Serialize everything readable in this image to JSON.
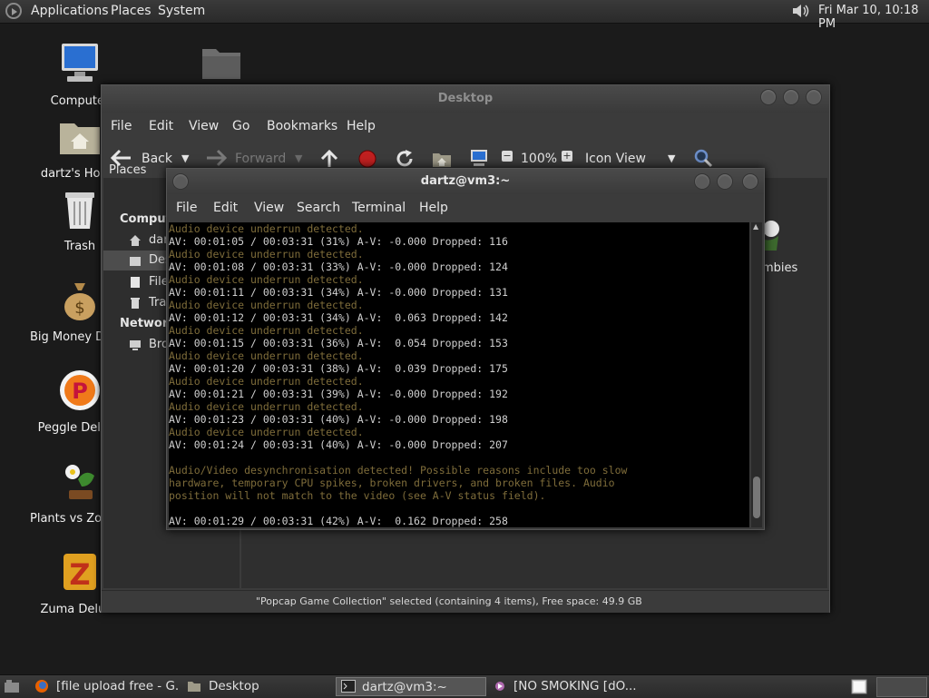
{
  "top_panel": {
    "menus": [
      "Applications",
      "Places",
      "System"
    ],
    "clock": "Fri Mar 10, 10:18 PM"
  },
  "desktop_icons": [
    {
      "label": "Computer",
      "icon": "computer-icon"
    },
    {
      "label": "dartz's Home",
      "icon": "home-folder-icon"
    },
    {
      "label": "Trash",
      "icon": "trash-icon"
    },
    {
      "label": "Big Money Deluxe",
      "icon": "money-bag-icon"
    },
    {
      "label": "Peggle Deluxe",
      "icon": "peggle-icon"
    },
    {
      "label": "Plants vs Zombies",
      "icon": "plants-icon"
    },
    {
      "label": "Zuma Deluxe",
      "icon": "zuma-icon"
    }
  ],
  "file_manager": {
    "title": "Desktop",
    "menu": [
      "File",
      "Edit",
      "View",
      "Go",
      "Bookmarks",
      "Help"
    ],
    "toolbar": {
      "back": "Back",
      "forward": "Forward",
      "zoom": "100%",
      "view_mode": "Icon View"
    },
    "sidebar_title": "Places",
    "sidebar": {
      "computer_header": "Computer",
      "items": [
        "dartz",
        "Desktop",
        "File System",
        "Trash"
      ],
      "network_header": "Network",
      "network_items": [
        "Browse Network"
      ]
    },
    "content_partial_label": "ombies",
    "status": "\"Popcap Game Collection\" selected (containing 4 items), Free space: 49.9 GB"
  },
  "terminal": {
    "title": "dartz@vm3:~",
    "menu": [
      "File",
      "Edit",
      "View",
      "Search",
      "Terminal",
      "Help"
    ],
    "lines": [
      {
        "text": "Audio device underrun detected.",
        "kind": "warn"
      },
      {
        "text": "AV: 00:01:05 / 00:03:31 (31%) A-V: -0.000 Dropped: 116",
        "kind": "norm"
      },
      {
        "text": "Audio device underrun detected.",
        "kind": "warn"
      },
      {
        "text": "AV: 00:01:08 / 00:03:31 (33%) A-V: -0.000 Dropped: 124",
        "kind": "norm"
      },
      {
        "text": "Audio device underrun detected.",
        "kind": "warn"
      },
      {
        "text": "AV: 00:01:11 / 00:03:31 (34%) A-V: -0.000 Dropped: 131",
        "kind": "norm"
      },
      {
        "text": "Audio device underrun detected.",
        "kind": "warn"
      },
      {
        "text": "AV: 00:01:12 / 00:03:31 (34%) A-V:  0.063 Dropped: 142",
        "kind": "norm"
      },
      {
        "text": "Audio device underrun detected.",
        "kind": "warn"
      },
      {
        "text": "AV: 00:01:15 / 00:03:31 (36%) A-V:  0.054 Dropped: 153",
        "kind": "norm"
      },
      {
        "text": "Audio device underrun detected.",
        "kind": "warn"
      },
      {
        "text": "AV: 00:01:20 / 00:03:31 (38%) A-V:  0.039 Dropped: 175",
        "kind": "norm"
      },
      {
        "text": "Audio device underrun detected.",
        "kind": "warn"
      },
      {
        "text": "AV: 00:01:21 / 00:03:31 (39%) A-V: -0.000 Dropped: 192",
        "kind": "norm"
      },
      {
        "text": "Audio device underrun detected.",
        "kind": "warn"
      },
      {
        "text": "AV: 00:01:23 / 00:03:31 (40%) A-V: -0.000 Dropped: 198",
        "kind": "norm"
      },
      {
        "text": "Audio device underrun detected.",
        "kind": "warn"
      },
      {
        "text": "AV: 00:01:24 / 00:03:31 (40%) A-V: -0.000 Dropped: 207",
        "kind": "norm"
      },
      {
        "text": "",
        "kind": "norm"
      },
      {
        "text": "Audio/Video desynchronisation detected! Possible reasons include too slow",
        "kind": "warn"
      },
      {
        "text": "hardware, temporary CPU spikes, broken drivers, and broken files. Audio",
        "kind": "warn"
      },
      {
        "text": "position will not match to the video (see A-V status field).",
        "kind": "warn"
      },
      {
        "text": "",
        "kind": "norm"
      },
      {
        "text": "AV: 00:01:29 / 00:03:31 (42%) A-V:  0.162 Dropped: 258",
        "kind": "norm"
      }
    ]
  },
  "taskbar": [
    {
      "label": "[file upload free - G...",
      "icon": "firefox-icon"
    },
    {
      "label": "Desktop",
      "icon": "file-manager-icon"
    },
    {
      "label": "dartz@vm3:~",
      "icon": "terminal-icon"
    },
    {
      "label": "[NO SMOKING [dO...",
      "icon": "media-player-icon"
    }
  ],
  "colors": {
    "terminal_warn": "#7e6c3a",
    "terminal_text": "#d0d0d0",
    "panel": "#2e2e2e"
  }
}
